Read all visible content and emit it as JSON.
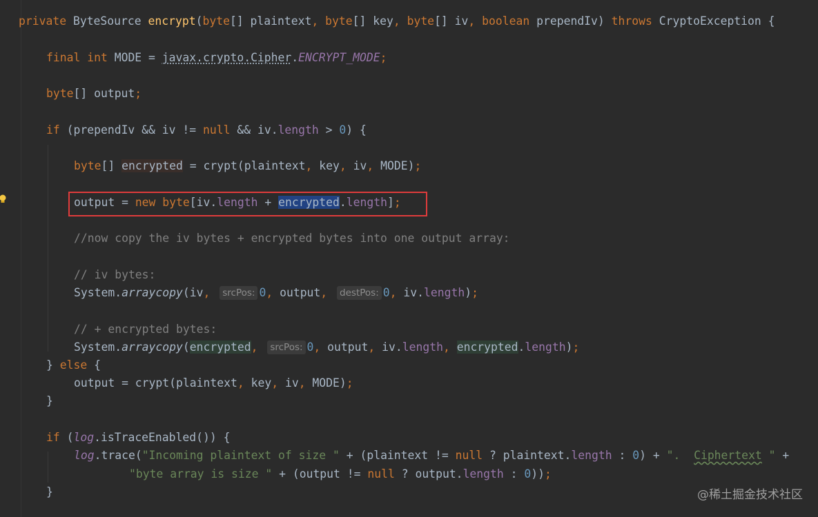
{
  "code": {
    "l1": {
      "kw_private": "private",
      "type": "ByteSource",
      "method": "encrypt",
      "p_open": "(",
      "kw_byte1": "byte",
      "arr1": "[] plaintext",
      "c1": ",",
      "kw_byte2": "byte",
      "arr2": "[] key",
      "c2": ",",
      "kw_byte3": "byte",
      "arr3": "[] iv",
      "c3": ",",
      "kw_boolean": "boolean",
      "p4": "prependIv)",
      "kw_throws": "throws",
      "exc": "CryptoException {"
    },
    "l2": {
      "kw_final": "final",
      "kw_int": "int",
      "name": "MODE = ",
      "pkg": "javax.crypto.Cipher",
      "dot": ".",
      "const": "ENCRYPT_MODE",
      "semi": ";"
    },
    "l3": {
      "kw_byte": "byte",
      "rest": "[] output",
      "semi": ";"
    },
    "l4": {
      "kw_if": "if",
      "a": "(prependIv && iv != ",
      "kw_null": "null",
      "b": " && iv.",
      "fld": "length",
      "c": " > ",
      "num": "0",
      "d": ") {"
    },
    "l5": {
      "kw_byte": "byte",
      "a": "[] ",
      "var": "encrypted",
      "b": " = crypt(plaintext",
      "c1": ",",
      "b2": " key",
      "c2": ",",
      "b3": " iv",
      "c3": ",",
      "b4": " MODE)",
      "semi": ";"
    },
    "l6": {
      "a": "output = ",
      "kw_new": "new",
      "kw_byte": "byte",
      "b": "[iv.",
      "fld1": "length",
      "c": " + ",
      "sel": "encrypted",
      "d": ".",
      "fld2": "length",
      "e": "]",
      "semi": ";"
    },
    "l7": {
      "cmt": "//now copy the iv bytes + encrypted bytes into one output array:"
    },
    "l8": {
      "cmt": "// iv bytes:"
    },
    "l9": {
      "a": "System.",
      "m": "arraycopy",
      "b": "(iv",
      "c1": ",",
      "hint1": "srcPos:",
      "n1": "0",
      "c2": ",",
      "b2": " output",
      "c3": ",",
      "hint2": "destPos:",
      "n2": "0",
      "c4": ",",
      "b3": " iv.",
      "fld": "length",
      "e": ")",
      "semi": ";"
    },
    "l10": {
      "cmt": "// + encrypted bytes:"
    },
    "l11": {
      "a": "System.",
      "m": "arraycopy",
      "b": "(",
      "var1": "encrypted",
      "c1": ",",
      "hint1": "srcPos:",
      "n1": "0",
      "c2": ",",
      "b2": " output",
      "c3": ",",
      "b3": " iv.",
      "fld1": "length",
      "c4": ",",
      "var2": "encrypted",
      "d": ".",
      "fld2": "length",
      "e": ")",
      "semi": ";"
    },
    "l12": {
      "a": "} ",
      "kw_else": "else",
      "b": " {"
    },
    "l13": {
      "a": "output = crypt(plaintext",
      "c1": ",",
      "b2": " key",
      "c2": ",",
      "b3": " iv",
      "c3": ",",
      "b4": " MODE)",
      "semi": ";"
    },
    "l14": {
      "a": "}"
    },
    "l15": {
      "kw_if": "if",
      "a": " (",
      "log": "log",
      "b": ".isTraceEnabled()) {"
    },
    "l16": {
      "log": "log",
      "a": ".trace(",
      "s1": "\"Incoming plaintext of size \"",
      "b": " + (plaintext != ",
      "kw_null": "null",
      "c": " ? plaintext.",
      "fld": "length",
      "d": " : ",
      "num": "0",
      "e": ") + ",
      "s2a": "\".  ",
      "s2w": "Ciphertext",
      "s2b": " \"",
      "f": " +"
    },
    "l17": {
      "s1": "\"byte array is size \"",
      "a": " + (output != ",
      "kw_null": "null",
      "b": " ? output.",
      "fld": "length",
      "c": " : ",
      "num": "0",
      "d": "))",
      "semi": ";"
    },
    "l18": {
      "a": "}"
    }
  },
  "watermark": "@稀土掘金技术社区",
  "colors": {
    "background": "#2b2b2b",
    "keyword": "#cc7832",
    "method": "#ffc66d",
    "number": "#6897bb",
    "comment": "#808080",
    "string": "#6a8759",
    "field": "#9876aa",
    "text": "#a9b7c6",
    "highlight_box": "#e03c3c",
    "selection": "#214283"
  },
  "icons": {
    "intention_bulb": "lightbulb-icon"
  }
}
